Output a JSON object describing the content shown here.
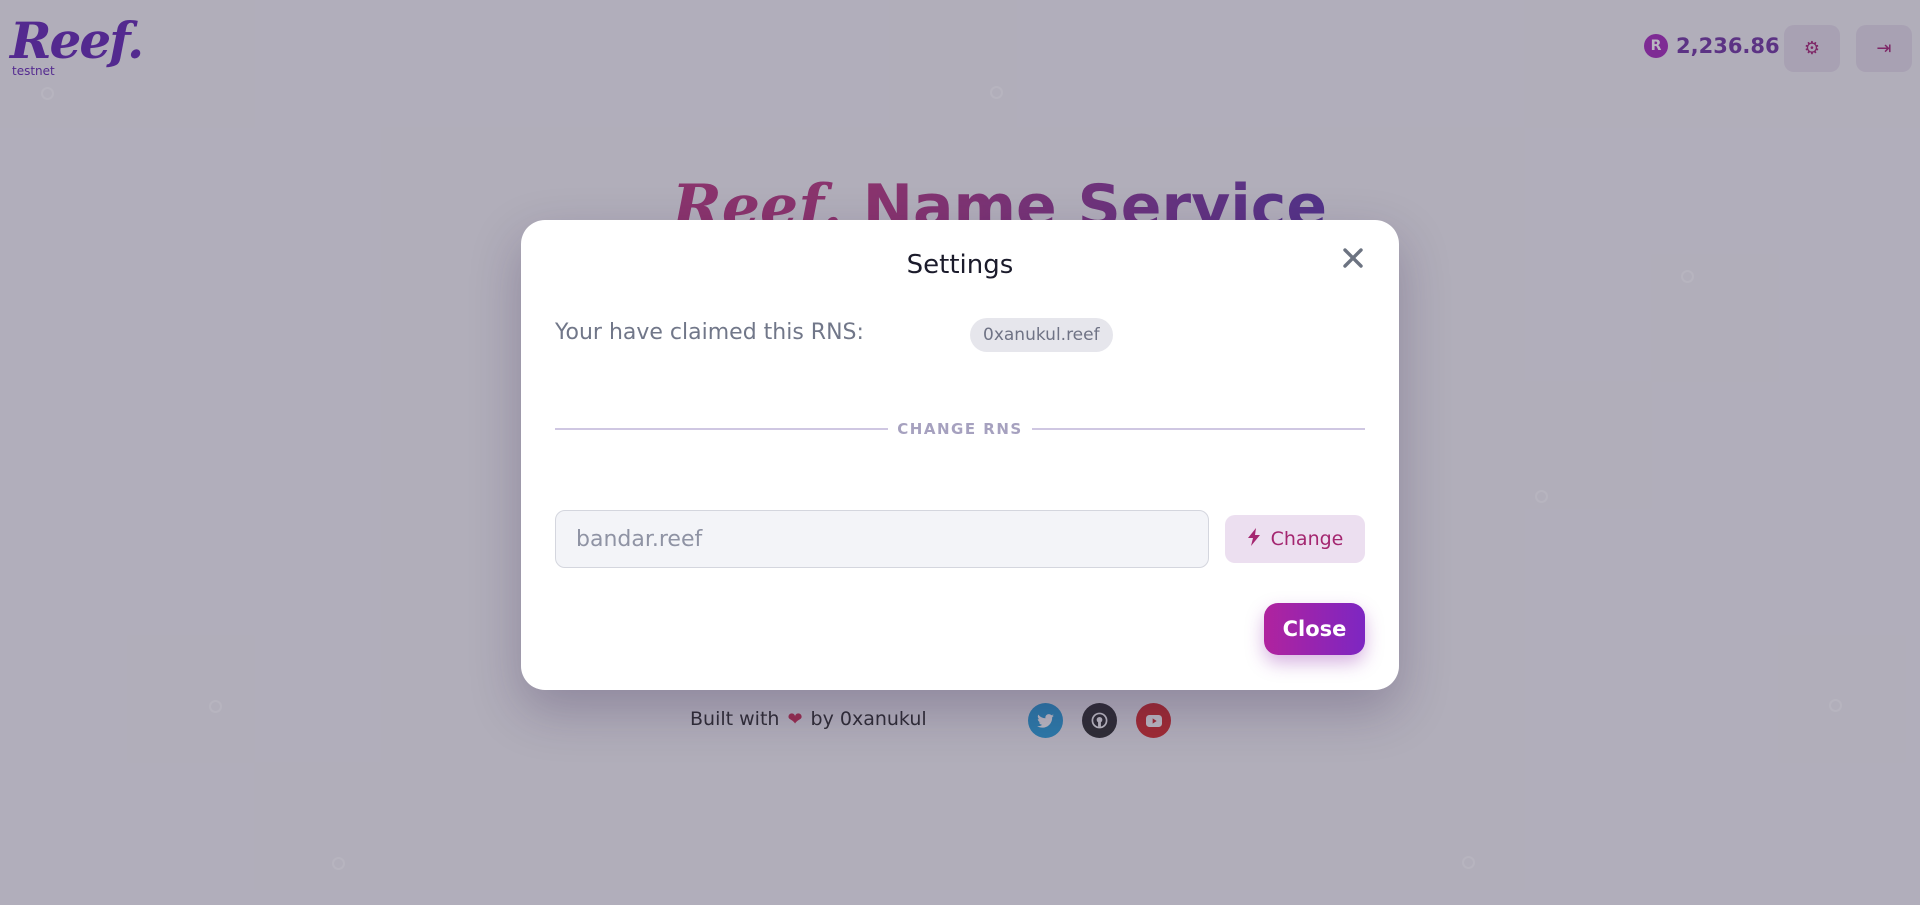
{
  "header": {
    "logo_text": "Reef.",
    "network_label": "testnet",
    "balance": "2,236.86",
    "coin_icon": "reef-coin-icon",
    "settings_icon": "gear-icon",
    "logout_icon": "logout-icon"
  },
  "hero": {
    "logo_text": "Reef.",
    "title": "Name Service"
  },
  "footer": {
    "built_with": "Built with",
    "heart": "❤",
    "by_author": "by 0xanukul",
    "socials": [
      {
        "name": "twitter",
        "icon": "twitter-icon",
        "color": "#1d9bd8"
      },
      {
        "name": "github",
        "icon": "github-icon",
        "color": "#222222"
      },
      {
        "name": "youtube",
        "icon": "youtube-icon",
        "color": "#d62020"
      }
    ]
  },
  "modal": {
    "title": "Settings",
    "close_icon": "close-icon",
    "claimed_label": "Your have claimed this RNS:",
    "claimed_name": "0xanukul.reef",
    "divider_label": "CHANGE RNS",
    "input_value": "",
    "input_placeholder": "bandar.reef",
    "change_label": "Change",
    "change_icon": "bolt-icon",
    "close_label": "Close"
  },
  "colors": {
    "brand_purple": "#5b1ab0",
    "accent_magenta": "#a42670",
    "close_gradient_start": "#b0239e",
    "close_gradient_end": "#7d26c2"
  }
}
